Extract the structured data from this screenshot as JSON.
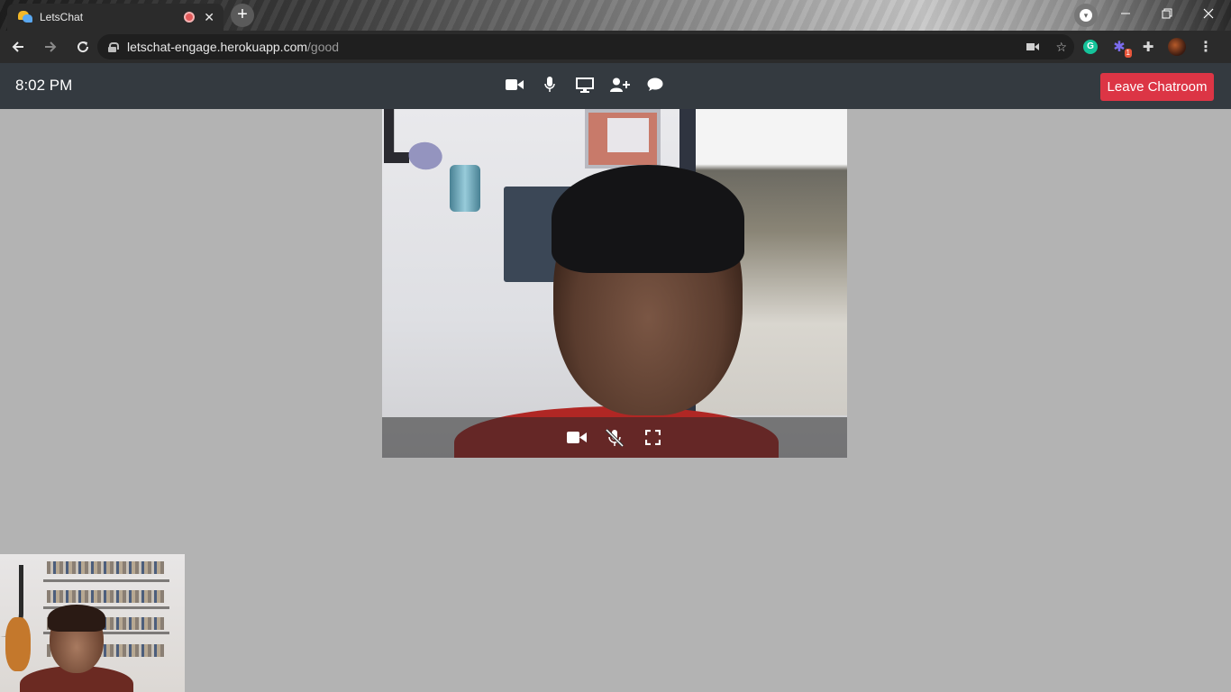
{
  "browser": {
    "tab_title": "LetsChat",
    "new_tab_symbol": "+",
    "tab_close_symbol": "✕",
    "url_host": "letschat-engage.herokuapp.com",
    "url_path": "/good",
    "extensions": {
      "grammarly_letter": "G",
      "badge_count": "1"
    },
    "window_controls": [
      "minimize",
      "restore",
      "close"
    ]
  },
  "app": {
    "clock": "8:02 PM",
    "toolbar_icons": [
      "video-camera-icon",
      "microphone-icon",
      "screen-share-icon",
      "add-user-icon",
      "chat-icon"
    ],
    "leave_button": "Leave Chatroom",
    "leave_button_color": "#dc3545",
    "navbar_color": "#343a40",
    "stage_color": "#b3b3b3"
  },
  "main_video": {
    "overlay_icons": [
      "video-camera-icon",
      "microphone-muted-icon",
      "fullscreen-icon"
    ]
  }
}
